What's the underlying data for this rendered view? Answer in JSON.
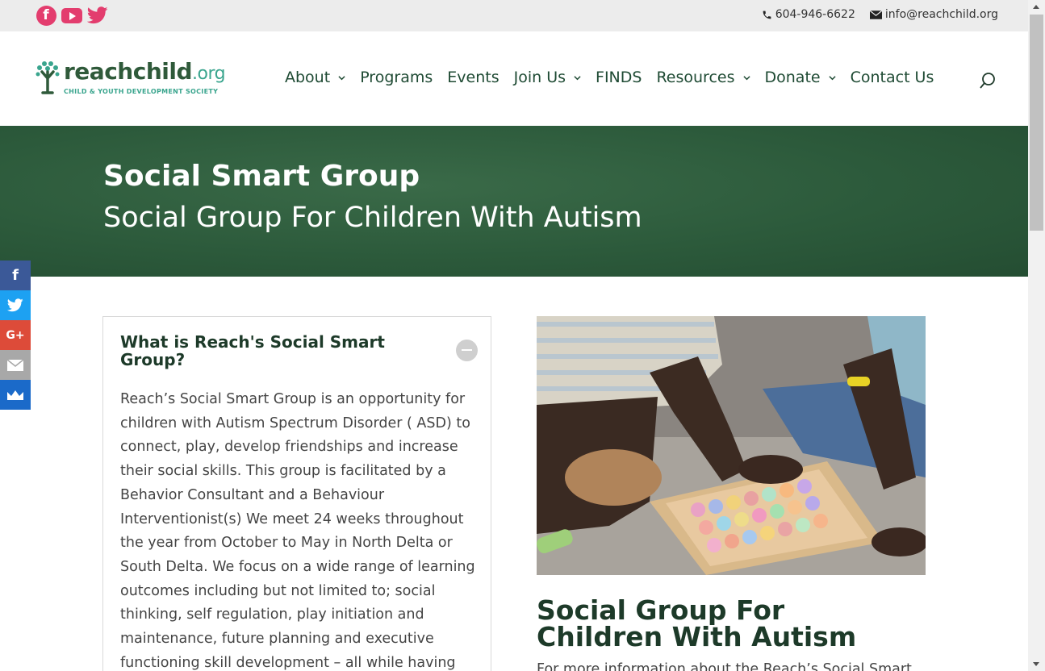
{
  "topbar": {
    "social": [
      {
        "icon": "facebook-icon",
        "glyph": "f"
      },
      {
        "icon": "youtube-icon"
      },
      {
        "icon": "twitter-icon"
      }
    ],
    "phone": "604-946-6622",
    "email": "info@reachchild.org"
  },
  "header": {
    "logo": {
      "main": "reachchild",
      "tld": ".org",
      "sub": "CHILD & YOUTH DEVELOPMENT SOCIETY"
    },
    "nav": [
      {
        "label": "About",
        "dropdown": true
      },
      {
        "label": "Programs",
        "dropdown": false
      },
      {
        "label": "Events",
        "dropdown": false
      },
      {
        "label": "Join Us",
        "dropdown": true
      },
      {
        "label": "FINDS",
        "dropdown": false
      },
      {
        "label": "Resources",
        "dropdown": true
      },
      {
        "label": "Donate",
        "dropdown": true
      },
      {
        "label": "Contact Us",
        "dropdown": false
      }
    ]
  },
  "hero": {
    "title": "Social Smart Group",
    "subtitle": "Social Group For Children With Autism"
  },
  "share": [
    {
      "icon": "facebook-icon",
      "glyph": "f",
      "color": "#3b5998"
    },
    {
      "icon": "twitter-icon",
      "glyph": "",
      "color": "#1da1f2"
    },
    {
      "icon": "google-plus-icon",
      "glyph": "G+",
      "color": "#dd4b39"
    },
    {
      "icon": "email-icon",
      "glyph": "",
      "color": "#a8a8a8"
    },
    {
      "icon": "sumome-icon",
      "glyph": "",
      "color": "#1b6ac9"
    }
  ],
  "accordion": {
    "title": "What is Reach's Social Smart Group?",
    "body": "Reach’s Social Smart Group is an opportunity for children with Autism Spectrum Disorder ( ASD)  to connect, play, develop friendships and increase their social skills. This group is facilitated by a Behavior Consultant and a Behaviour Interventionist(s)  We meet 24 weeks throughout the year from October to May in North Delta or South Delta. We focus on a wide range of learning outcomes including but not limited to; social thinking, self regulation, play initiation and maintenance, future planning and executive functioning skill development – all while having fun!"
  },
  "right": {
    "title": "Social Group For Children With Autism",
    "para": "For more information about the Reach’s Social Smart"
  },
  "colors": {
    "brand_green": "#2c5a3b",
    "heading_green": "#1d3a29",
    "accent_pink": "#e33d6e"
  }
}
